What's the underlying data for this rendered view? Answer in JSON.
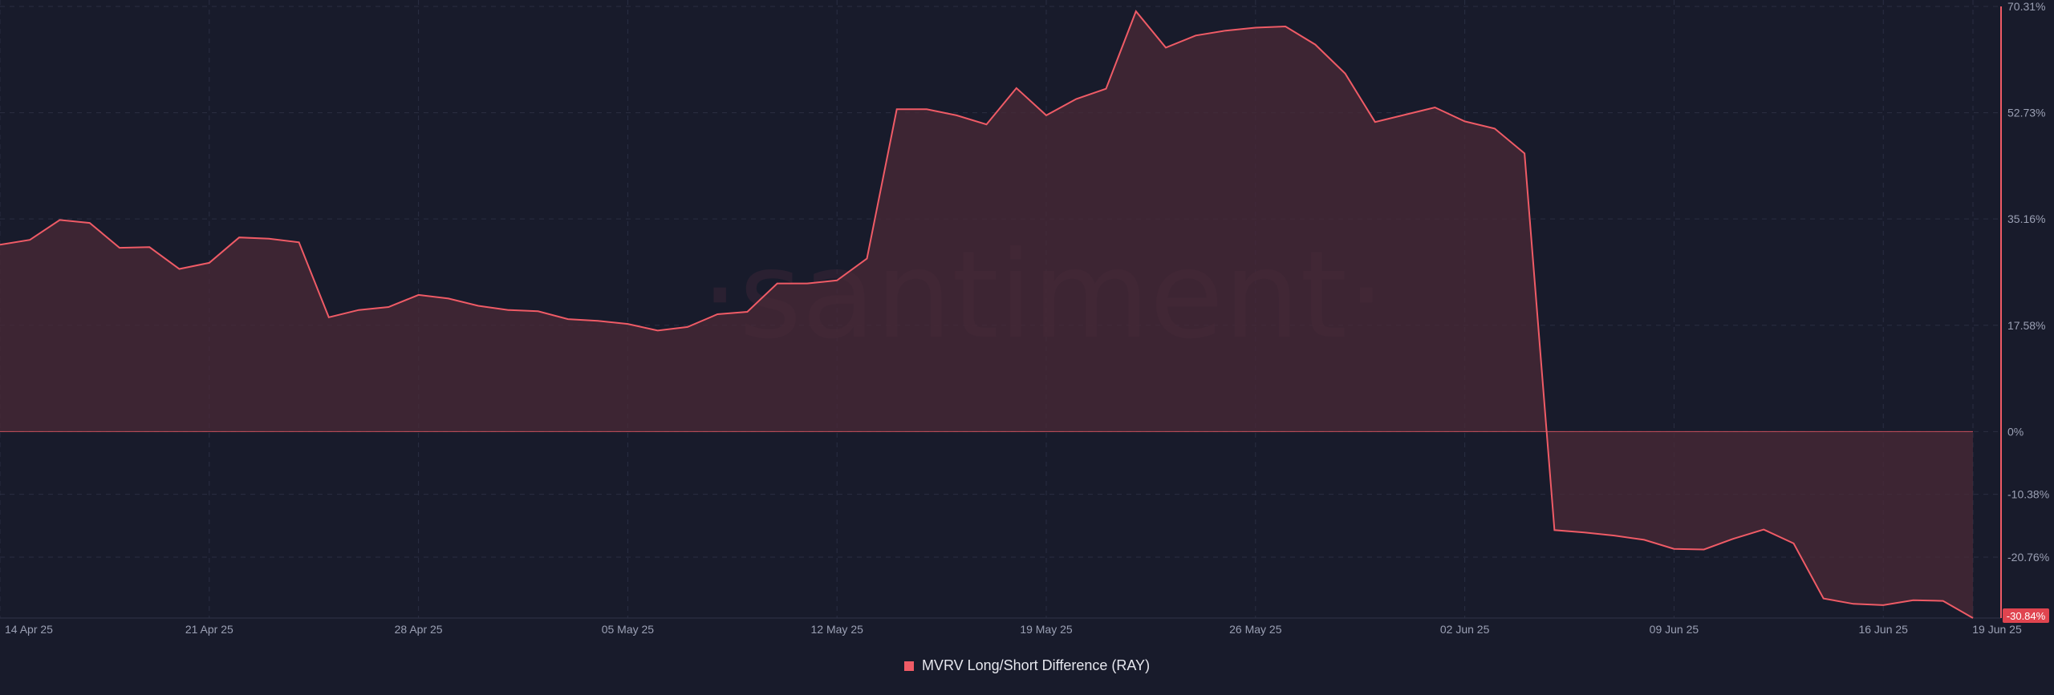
{
  "watermark": "·santiment·",
  "legend": {
    "label": "MVRV Long/Short Difference (RAY)"
  },
  "colors": {
    "line": "#ef5b66",
    "fill": "#4a2a37",
    "background": "#181b2b",
    "grid": "#2a2e42",
    "badge": "#e0444f"
  },
  "chart_data": {
    "type": "area",
    "title": "",
    "xlabel": "",
    "ylabel": "",
    "y_unit": "%",
    "ylim": [
      -30.84,
      70.31
    ],
    "yticks": [
      "70.31%",
      "52.73%",
      "35.16%",
      "17.58%",
      "0%",
      "-10.38%",
      "-20.76%"
    ],
    "ytick_values": [
      70.31,
      52.73,
      35.16,
      17.58,
      0,
      -10.38,
      -20.76
    ],
    "last_value_label": "-30.84%",
    "xticks": [
      "14 Apr 25",
      "21 Apr 25",
      "28 Apr 25",
      "05 May 25",
      "12 May 25",
      "19 May 25",
      "26 May 25",
      "02 Jun 25",
      "09 Jun 25",
      "16 Jun 25",
      "19 Jun 25"
    ],
    "grid": true,
    "legend_position": "bottom-center",
    "series": [
      {
        "name": "MVRV Long/Short Difference (RAY)",
        "x": [
          "2025-04-14",
          "2025-04-15",
          "2025-04-16",
          "2025-04-17",
          "2025-04-18",
          "2025-04-19",
          "2025-04-20",
          "2025-04-21",
          "2025-04-22",
          "2025-04-23",
          "2025-04-24",
          "2025-04-25",
          "2025-04-26",
          "2025-04-27",
          "2025-04-28",
          "2025-04-29",
          "2025-04-30",
          "2025-05-01",
          "2025-05-02",
          "2025-05-03",
          "2025-05-04",
          "2025-05-05",
          "2025-05-06",
          "2025-05-07",
          "2025-05-08",
          "2025-05-09",
          "2025-05-10",
          "2025-05-11",
          "2025-05-12",
          "2025-05-13",
          "2025-05-14",
          "2025-05-15",
          "2025-05-16",
          "2025-05-17",
          "2025-05-18",
          "2025-05-19",
          "2025-05-20",
          "2025-05-21",
          "2025-05-22",
          "2025-05-23",
          "2025-05-24",
          "2025-05-25",
          "2025-05-26",
          "2025-05-27",
          "2025-05-28",
          "2025-05-29",
          "2025-05-30",
          "2025-05-31",
          "2025-06-01",
          "2025-06-02",
          "2025-06-03",
          "2025-06-04",
          "2025-06-05",
          "2025-06-06",
          "2025-06-07",
          "2025-06-08",
          "2025-06-09",
          "2025-06-10",
          "2025-06-11",
          "2025-06-12",
          "2025-06-13",
          "2025-06-14",
          "2025-06-15",
          "2025-06-16",
          "2025-06-17",
          "2025-06-18",
          "2025-06-19"
        ],
        "values": [
          30.9,
          31.7,
          35.0,
          34.5,
          30.4,
          30.5,
          26.9,
          27.9,
          32.1,
          31.9,
          31.3,
          18.9,
          20.1,
          20.6,
          22.6,
          22.0,
          20.8,
          20.1,
          19.9,
          18.6,
          18.3,
          17.8,
          16.7,
          17.3,
          19.4,
          19.8,
          24.5,
          24.5,
          25.0,
          28.6,
          53.3,
          53.3,
          52.3,
          50.8,
          56.8,
          52.3,
          55.0,
          56.7,
          69.5,
          63.5,
          65.5,
          66.3,
          66.8,
          67.0,
          64.0,
          59.2,
          51.2,
          52.4,
          53.6,
          51.3,
          50.1,
          46.0,
          -16.3,
          -16.7,
          -17.2,
          -17.9,
          -19.4,
          -19.5,
          -17.7,
          -16.2,
          -18.5,
          -27.6,
          -28.5,
          -28.7,
          -27.9,
          -28.0,
          -30.84
        ]
      }
    ]
  }
}
